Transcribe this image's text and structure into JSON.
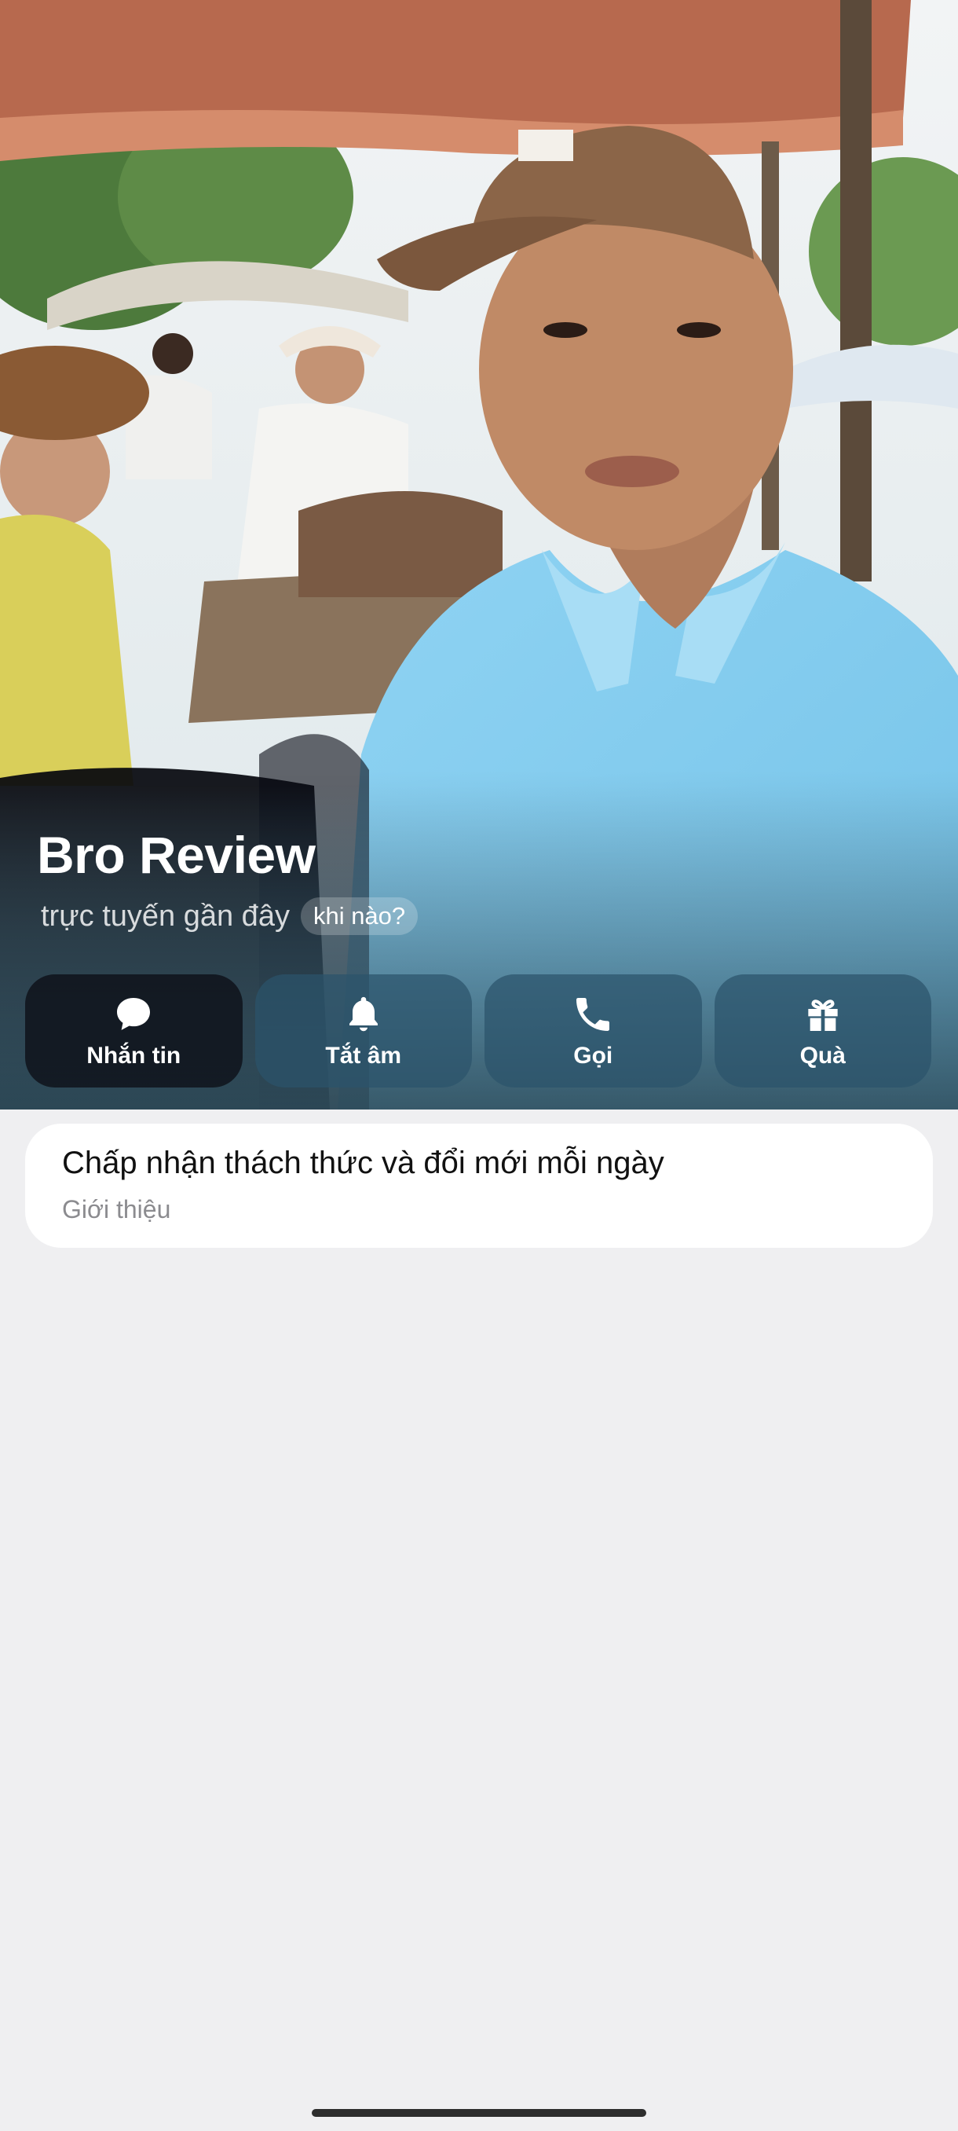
{
  "profile": {
    "name": "Bro Review",
    "status_text": "trực tuyến gần đây",
    "status_chip": "khi nào?"
  },
  "actions": [
    {
      "label": "Nhắn tin",
      "icon": "chat-bubble-icon"
    },
    {
      "label": "Tắt âm",
      "icon": "bell-icon"
    },
    {
      "label": "Gọi",
      "icon": "phone-icon"
    },
    {
      "label": "Quà",
      "icon": "gift-icon"
    }
  ],
  "about": {
    "text": "Chấp nhận thách thức và đổi mới mỗi ngày",
    "label": "Giới thiệu"
  }
}
